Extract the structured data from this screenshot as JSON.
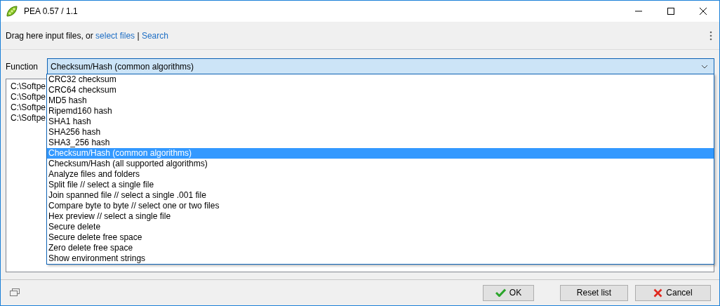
{
  "window": {
    "title": "PEA 0.57 / 1.1"
  },
  "header": {
    "prompt": "Drag here input files, or ",
    "links": [
      {
        "label": "select files"
      },
      {
        "label": "Search"
      }
    ],
    "separator": "|"
  },
  "function": {
    "label": "Function",
    "value": "Checksum/Hash (common algorithms)",
    "expanded": true,
    "options": [
      {
        "label": "CRC32 checksum",
        "selected": false
      },
      {
        "label": "CRC64 checksum",
        "selected": false
      },
      {
        "label": "MD5 hash",
        "selected": false
      },
      {
        "label": "Ripemd160 hash",
        "selected": false
      },
      {
        "label": "SHA1 hash",
        "selected": false
      },
      {
        "label": "SHA256 hash",
        "selected": false
      },
      {
        "label": "SHA3_256 hash",
        "selected": false
      },
      {
        "label": "Checksum/Hash (common algorithms)",
        "selected": true
      },
      {
        "label": "Checksum/Hash (all supported algorithms)",
        "selected": false
      },
      {
        "label": "Analyze files and folders",
        "selected": false
      },
      {
        "label": "Split file // select a single file",
        "selected": false
      },
      {
        "label": "Join spanned file // select a single .001 file",
        "selected": false
      },
      {
        "label": "Compare byte to byte // select one or two files",
        "selected": false
      },
      {
        "label": "Hex preview // select a single file",
        "selected": false
      },
      {
        "label": "Secure delete",
        "selected": false
      },
      {
        "label": "Secure delete free space",
        "selected": false
      },
      {
        "label": "Zero delete free space",
        "selected": false
      },
      {
        "label": "Show environment strings",
        "selected": false
      }
    ]
  },
  "files": [
    "C:\\Softpe",
    "C:\\Softpe",
    "C:\\Softpe",
    "C:\\Softpe"
  ],
  "buttons": [
    {
      "kind": "ok",
      "label": "OK"
    },
    {
      "kind": "plain",
      "label": "Reset list"
    },
    {
      "kind": "cancel",
      "label": "Cancel"
    }
  ]
}
